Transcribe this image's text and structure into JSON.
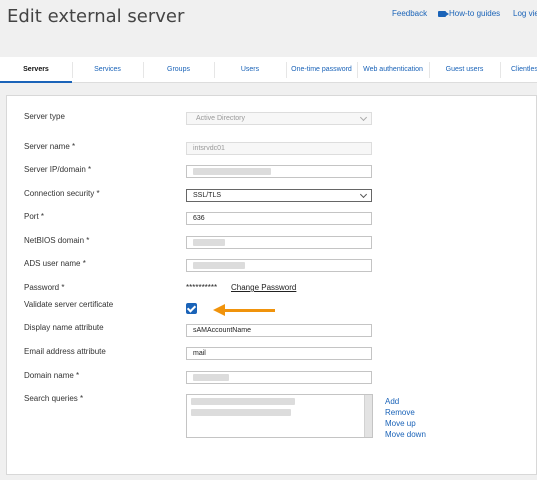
{
  "header": {
    "title": "Edit external server",
    "links": {
      "feedback": "Feedback",
      "howto": "How-to guides",
      "log": "Log vie"
    }
  },
  "tabs": [
    "Servers",
    "Services",
    "Groups",
    "Users",
    "One-time password",
    "Web authentication",
    "Guest users",
    "Clientles"
  ],
  "active_tab": "Servers",
  "form": {
    "server_type": {
      "label": "Server type",
      "value": "Active Directory"
    },
    "server_name": {
      "label": "Server name *",
      "value": "intsrvdc01"
    },
    "server_ip": {
      "label": "Server IP/domain *",
      "value": ""
    },
    "connection_security": {
      "label": "Connection security *",
      "value": "SSL/TLS"
    },
    "port": {
      "label": "Port *",
      "value": "636"
    },
    "netbios": {
      "label": "NetBIOS domain *",
      "value": ""
    },
    "ads_user": {
      "label": "ADS user name *",
      "value": ""
    },
    "password": {
      "label": "Password *",
      "value": "**********",
      "change_link": "Change Password"
    },
    "validate_cert": {
      "label": "Validate server certificate",
      "checked": true
    },
    "display_name_attr": {
      "label": "Display name attribute",
      "value": "sAMAccountName"
    },
    "email_attr": {
      "label": "Email address attribute",
      "value": "mail"
    },
    "domain_name": {
      "label": "Domain name *",
      "value": ""
    },
    "search_queries": {
      "label": "Search queries *",
      "actions": [
        "Add",
        "Remove",
        "Move up",
        "Move down"
      ]
    }
  },
  "colors": {
    "accent": "#1a63b8",
    "arrow": "#f0930c"
  }
}
